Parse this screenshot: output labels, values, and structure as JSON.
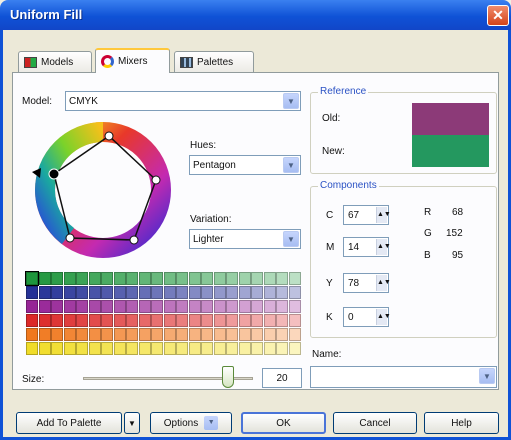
{
  "window": {
    "title": "Uniform Fill",
    "close_glyph": "✕"
  },
  "tabs": [
    {
      "label": "Models",
      "icon": "models-icon",
      "active": false
    },
    {
      "label": "Mixers",
      "icon": "mixers-icon",
      "active": true
    },
    {
      "label": "Palettes",
      "icon": "palettes-icon",
      "active": false
    }
  ],
  "model": {
    "label": "Model:",
    "value": "CMYK"
  },
  "hues": {
    "label": "Hues:",
    "value": "Pentagon"
  },
  "variation": {
    "label": "Variation:",
    "value": "Lighter"
  },
  "reference": {
    "title": "Reference",
    "old_label": "Old:",
    "new_label": "New:",
    "old_color": "#8c3a78",
    "new_color": "#24985f"
  },
  "components": {
    "title": "Components",
    "cmyk": [
      {
        "label": "C",
        "value": "67"
      },
      {
        "label": "M",
        "value": "14"
      },
      {
        "label": "Y",
        "value": "78"
      },
      {
        "label": "K",
        "value": "0"
      }
    ],
    "rgb": [
      {
        "label": "R",
        "value": "68"
      },
      {
        "label": "G",
        "value": "152"
      },
      {
        "label": "B",
        "value": "95"
      }
    ]
  },
  "name": {
    "label": "Name:",
    "value": ""
  },
  "size": {
    "label": "Size:",
    "value": "20",
    "slider_fraction": 0.85
  },
  "buttons": {
    "add_to_palette": "Add To Palette",
    "options": "Options",
    "ok": "OK",
    "cancel": "Cancel",
    "help": "Help"
  },
  "colors": {
    "accent": "#0f52d6",
    "tab_highlight": "#ffc83c",
    "group_title": "#2b52c4"
  }
}
